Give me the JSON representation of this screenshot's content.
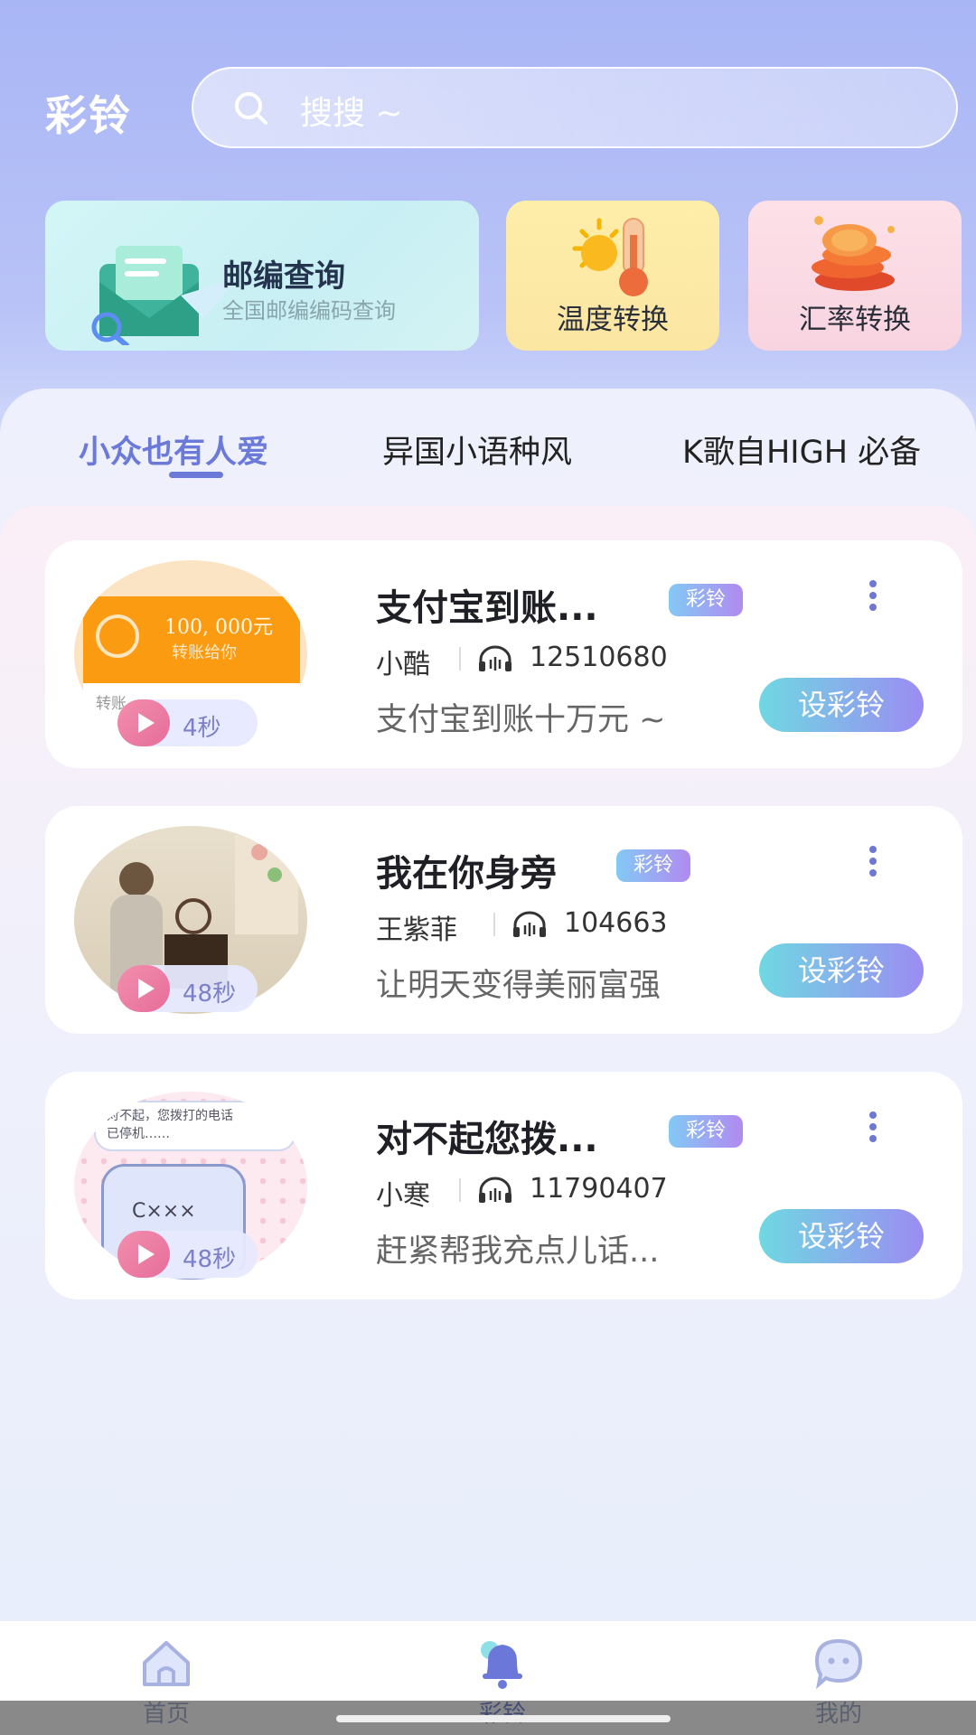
{
  "header": {
    "title": "彩铃",
    "search_placeholder": "搜搜 ~"
  },
  "tools": {
    "postcode": {
      "title": "邮编查询",
      "subtitle": "全国邮编编码查询"
    },
    "temperature": {
      "label": "温度转换"
    },
    "exchange": {
      "label": "汇率转换"
    }
  },
  "tabs": [
    {
      "label": "小众也有人爱",
      "active": true
    },
    {
      "label": "异国小语种风",
      "active": false
    },
    {
      "label": "K歌自HIGH 必备",
      "active": false
    }
  ],
  "songs": [
    {
      "title": "支付宝到账...",
      "badge": "彩铃",
      "singer": "小酷",
      "plays": "12510680",
      "desc": "支付宝到账十万元 ~",
      "duration": "4秒",
      "button": "设彩铃",
      "thumb_text": {
        "amount": "100, 000元",
        "caption": "转账给你",
        "footer": "转账"
      }
    },
    {
      "title": "我在你身旁",
      "badge": "彩铃",
      "singer": "王紫菲",
      "plays": "104663",
      "desc": "让明天变得美丽富强",
      "duration": "48秒",
      "button": "设彩铃"
    },
    {
      "title": "对不起您拨...",
      "badge": "彩铃",
      "singer": "小寒",
      "plays": "11790407",
      "desc": "赶紧帮我充点儿话...",
      "duration": "48秒",
      "button": "设彩铃",
      "thumb_text": {
        "line1": "对不起，您拨打的电话",
        "line2": "已停机……",
        "phone": "C×××"
      }
    }
  ],
  "nav": [
    {
      "label": "首页",
      "icon": "home-icon",
      "active": false
    },
    {
      "label": "彩铃",
      "icon": "bell-icon",
      "active": true
    },
    {
      "label": "我的",
      "icon": "chat-face-icon",
      "active": false
    }
  ],
  "colors": {
    "accent": "#6b7ad8",
    "button_start": "#6fd8e2",
    "button_end": "#9b8cf2",
    "badge_start": "#83c9f5",
    "badge_end": "#b18af0"
  }
}
